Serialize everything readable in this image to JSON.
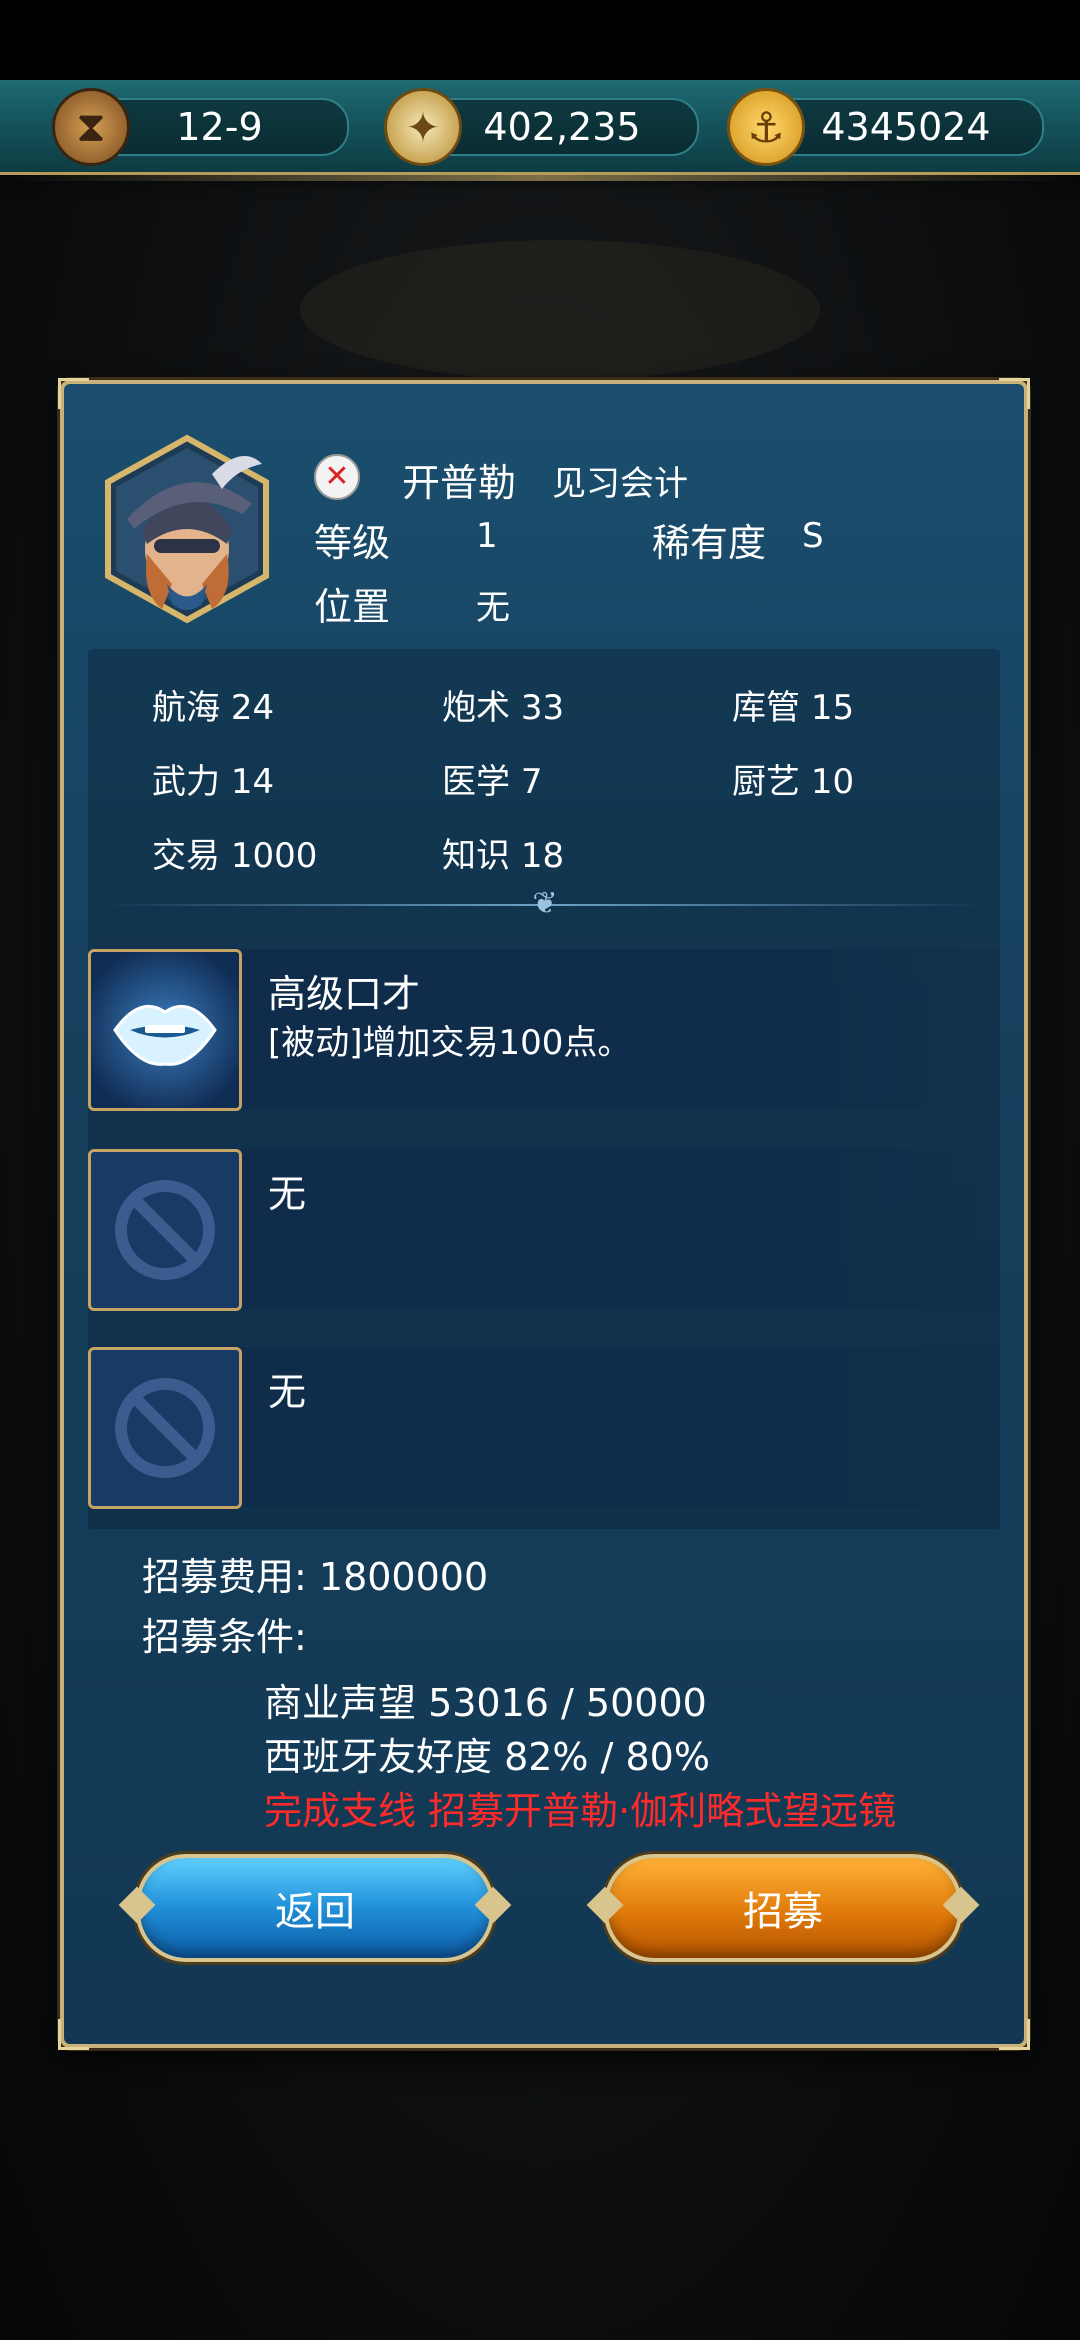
{
  "resources": {
    "stage": "12-9",
    "compass_value": "402,235",
    "gold": "4345024"
  },
  "officer": {
    "name": "开普勒",
    "title": "见习会计",
    "level_label": "等级",
    "level": "1",
    "rarity_label": "稀有度",
    "rarity": "S",
    "position_label": "位置",
    "position": "无"
  },
  "stats": [
    {
      "label": "航海",
      "value": "24"
    },
    {
      "label": "炮术",
      "value": "33"
    },
    {
      "label": "库管",
      "value": "15"
    },
    {
      "label": "武力",
      "value": "14"
    },
    {
      "label": "医学",
      "value": "7"
    },
    {
      "label": "厨艺",
      "value": "10"
    },
    {
      "label": "交易",
      "value": "1000"
    },
    {
      "label": "知识",
      "value": "18"
    }
  ],
  "skills": [
    {
      "name": "高级口才",
      "desc": "[被动]增加交易100点。"
    },
    {
      "name": "无",
      "desc": ""
    },
    {
      "name": "无",
      "desc": ""
    }
  ],
  "recruit": {
    "cost_label": "招募费用:",
    "cost": "1800000",
    "cond_label": "招募条件:",
    "cond1": "商业声望 53016 / 50000",
    "cond2": "西班牙友好度 82% / 80%",
    "cond3": "完成支线 招募开普勒·伽利略式望远镜"
  },
  "buttons": {
    "back": "返回",
    "recruit": "招募"
  },
  "colors": {
    "panel": "#163f5c",
    "gold_border": "#c7b27b",
    "warning_red": "#ff2a2a",
    "back_button": "#1f8fd8",
    "recruit_button": "#e07a0a"
  }
}
